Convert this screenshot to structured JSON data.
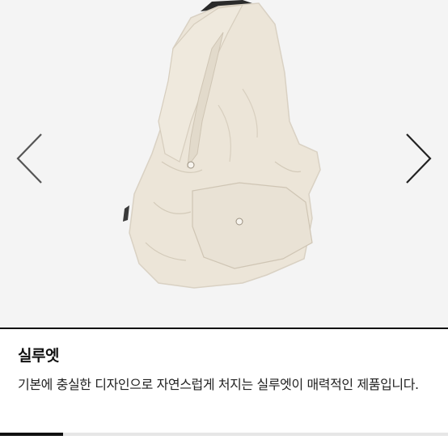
{
  "section": {
    "title": "실루엣",
    "description": "기본에 충실한 디자인으로 자연스럽게 처지는 실루엣이 매력적인 제품입니다."
  },
  "navigation": {
    "prev_icon": "chevron-left-icon",
    "next_icon": "chevron-right-icon"
  },
  "slider": {
    "progress": 0.14
  },
  "colors": {
    "photo_background": "#f4f4f4",
    "bag": "#ece5d8",
    "accent": "#111111"
  }
}
